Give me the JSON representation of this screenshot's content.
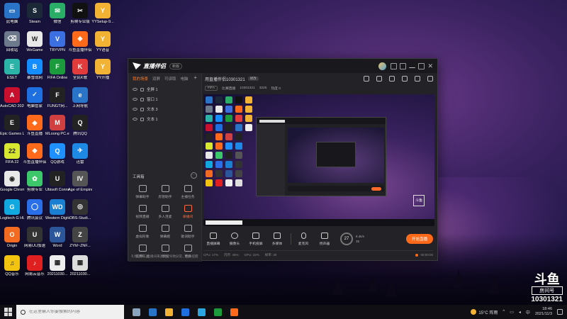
{
  "desktop": {
    "icons": [
      {
        "label": "此电脑",
        "color": "#2a74c8",
        "glyph": "▭"
      },
      {
        "label": "Steam",
        "color": "#1b2838",
        "glyph": "S"
      },
      {
        "label": "微信",
        "color": "#2aae67",
        "glyph": "✉"
      },
      {
        "label": "剪映专业版",
        "color": "#111111",
        "glyph": "✂"
      },
      {
        "label": "YYSetup-9...",
        "color": "#f2b233",
        "glyph": "Y"
      },
      {
        "label": "回收站",
        "color": "#6c7a8c",
        "glyph": "⌫"
      },
      {
        "label": "WeGame",
        "color": "#e8e8e8",
        "glyph": "W"
      },
      {
        "label": "TBYVPN",
        "color": "#3c6fe0",
        "glyph": "V"
      },
      {
        "label": "斗鱼直播伴侣",
        "color": "#ff6a1a",
        "glyph": "◆"
      },
      {
        "label": "YY语音",
        "color": "#f2b233",
        "glyph": "Y"
      },
      {
        "label": "ESET",
        "color": "#2bb3a8",
        "glyph": "E"
      },
      {
        "label": "暴雪战网",
        "color": "#148eff",
        "glyph": "B"
      },
      {
        "label": "FIFA Online",
        "color": "#1c9b3c",
        "glyph": "F"
      },
      {
        "label": "全民K歌",
        "color": "#e23b3b",
        "glyph": "K"
      },
      {
        "label": "YY开播",
        "color": "#f2b233",
        "glyph": "Y"
      },
      {
        "label": "AutoCAD 2020 - 简...",
        "color": "#c8102e",
        "glyph": "A"
      },
      {
        "label": "电脑管家",
        "color": "#1e6fe0",
        "glyph": "✓"
      },
      {
        "label": "FUNGT网...",
        "color": "#222222",
        "glyph": "F"
      },
      {
        "label": "上网导航",
        "color": "#2a74c8",
        "glyph": "e"
      },
      {
        "label": "",
        "color": "#eeeeee",
        "glyph": ""
      },
      {
        "label": "Epic Games Launcher",
        "color": "#222222",
        "glyph": "E"
      },
      {
        "label": "斗鱼直播",
        "color": "#ff6a1a",
        "glyph": "◆"
      },
      {
        "label": "MLoong PC.exe",
        "color": "#d04040",
        "glyph": "M"
      },
      {
        "label": "腾讯QQ",
        "color": "#222222",
        "glyph": "Q"
      },
      {
        "label": "",
        "color": "rgba(0,0,0,0)",
        "glyph": ""
      },
      {
        "label": "FIFA 22",
        "color": "#d8e830",
        "glyph": "22"
      },
      {
        "label": "斗鱼直播伴侣",
        "color": "#ff6a1a",
        "glyph": "◆"
      },
      {
        "label": "QQ游戏",
        "color": "#1e90ff",
        "glyph": "Q"
      },
      {
        "label": "迅雷",
        "color": "#1e88e5",
        "glyph": "✈"
      },
      {
        "label": "",
        "color": "rgba(0,0,0,0)",
        "glyph": ""
      },
      {
        "label": "Google Chrome",
        "color": "#e8e8e8",
        "glyph": "◉"
      },
      {
        "label": "剪映专业",
        "color": "#3cc86a",
        "glyph": "✿"
      },
      {
        "label": "Ubisoft Connect",
        "color": "#222222",
        "glyph": "U"
      },
      {
        "label": "Age of Empires IV",
        "color": "#555555",
        "glyph": "IV"
      },
      {
        "label": "",
        "color": "rgba(0,0,0,0)",
        "glyph": ""
      },
      {
        "label": "Logitech G HUB",
        "color": "#11a8e0",
        "glyph": "G"
      },
      {
        "label": "腾讯会议",
        "color": "#2a6ee8",
        "glyph": "◯"
      },
      {
        "label": "Western Digital S...",
        "color": "#1a7fd0",
        "glyph": "WD"
      },
      {
        "label": "OBS-Studi...",
        "color": "#333333",
        "glyph": "◎"
      },
      {
        "label": "",
        "color": "rgba(0,0,0,0)",
        "glyph": ""
      },
      {
        "label": "Origin",
        "color": "#f36b21",
        "glyph": "O"
      },
      {
        "label": "网易UU加速",
        "color": "#333333",
        "glyph": "U"
      },
      {
        "label": "Word",
        "color": "#2b579a",
        "glyph": "W"
      },
      {
        "label": "ZYM~ZNF...",
        "color": "#444444",
        "glyph": "Z"
      },
      {
        "label": "",
        "color": "rgba(0,0,0,0)",
        "glyph": ""
      },
      {
        "label": "QQ音乐",
        "color": "#f2c40f",
        "glyph": "♫"
      },
      {
        "label": "网易云音乐",
        "color": "#e02020",
        "glyph": "♪"
      },
      {
        "label": "20211030...",
        "color": "#eeeeee",
        "glyph": "▦"
      },
      {
        "label": "20211030...",
        "color": "#dddddd",
        "glyph": "▦"
      },
      {
        "label": "",
        "color": "rgba(0,0,0,0)",
        "glyph": ""
      }
    ]
  },
  "app": {
    "brand": "直播伴侣",
    "version": "新版",
    "left_tabs": [
      "我的场景",
      "双屏",
      "可读取",
      "电脑"
    ],
    "layers": [
      "全屏 1",
      "窗口 1",
      "文本 3",
      "文本 1"
    ],
    "tools_title": "工具箱",
    "more_label": "···",
    "tools": [
      {
        "label": "弹幕助手",
        "highlight": false
      },
      {
        "label": "房管助手",
        "highlight": false
      },
      {
        "label": "主播任务",
        "highlight": false
      },
      {
        "label": "视频直播",
        "highlight": false
      },
      {
        "label": "多人连麦",
        "highlight": false
      },
      {
        "label": "录播间",
        "highlight": true
      },
      {
        "label": "虚拟形象",
        "highlight": false
      },
      {
        "label": "弹幕姬",
        "highlight": false
      },
      {
        "label": "歌词助手",
        "highlight": false
      },
      {
        "label": "实用工具",
        "highlight": false
      },
      {
        "label": "添加",
        "highlight": false
      },
      {
        "label": "更多",
        "highlight": false
      }
    ],
    "notice": "礼物仅供、直播间来源可能导致异常，谢谢提醒",
    "room_title": "用直播伴侣10301321",
    "room_edit": "修改",
    "room_category": "FIFA",
    "room_sub_items": [
      "比赛直播",
      "10301321",
      "3225",
      "热度 0"
    ],
    "watermark_text": "斗鱼",
    "controls": [
      {
        "label": "直播屏幕"
      },
      {
        "label": "摄像头"
      },
      {
        "label": "手机投屏"
      },
      {
        "label": "多媒体"
      },
      {
        "label": "麦克风"
      },
      {
        "label": "扬声器"
      }
    ],
    "gauge_value": "27",
    "speeds": [
      "8.4k/s",
      "35"
    ],
    "start_button": "开始直播",
    "status_items": [
      "CPU: 17%",
      "内存: 45%",
      "GPU: 22%",
      "帧率: 30"
    ],
    "status_time": "00:00:00"
  },
  "overlay": {
    "logo": "斗鱼",
    "sub": "房间号",
    "room_number": "10301321"
  },
  "taskbar": {
    "search_placeholder": "在这里输入你要搜索的内容",
    "weather_temp": "15°C 阵雨",
    "tray_lang": "中",
    "clock_time": "18:46",
    "clock_date": "2021/11/3",
    "apps": [
      "#8aa4c0",
      "#2a74c8",
      "#f2b233",
      "#1e6fe0",
      "#2aa7e0",
      "#1c9b3c",
      "#ff6a1a"
    ]
  }
}
